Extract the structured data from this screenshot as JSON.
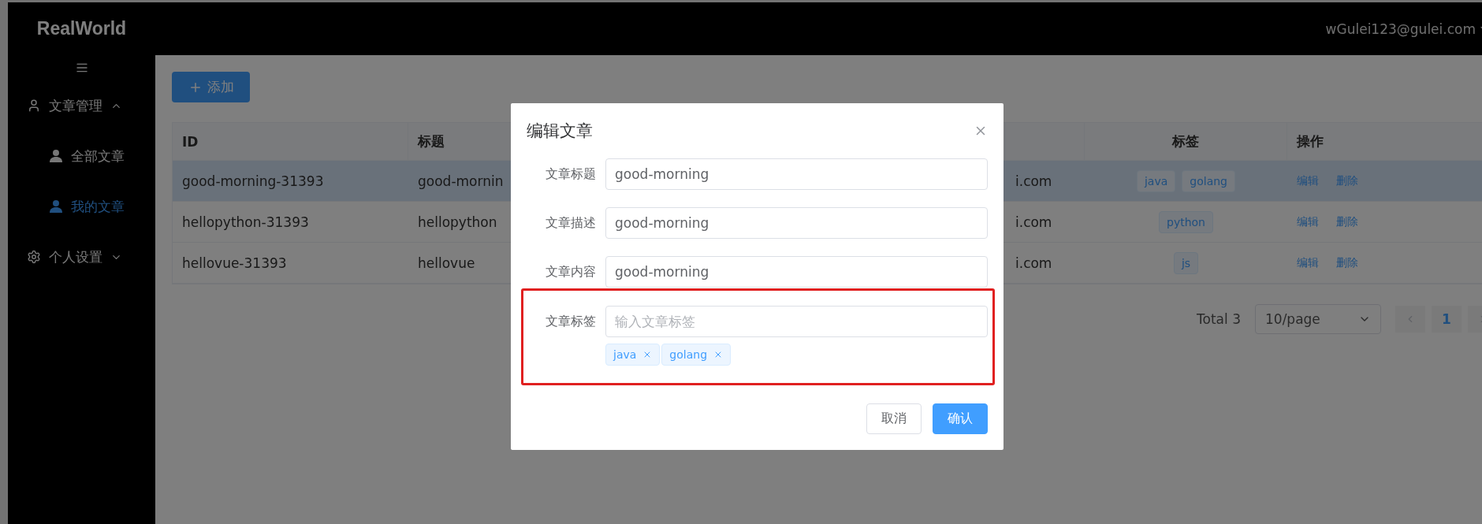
{
  "header": {
    "logo": "RealWorld",
    "user": "wGulei123@gulei.com"
  },
  "sidebar": {
    "items": [
      {
        "label": "文章管理",
        "expanded": true,
        "children": [
          {
            "label": "全部文章",
            "selected": false
          },
          {
            "label": "我的文章",
            "selected": true
          }
        ]
      },
      {
        "label": "个人设置",
        "expanded": false
      }
    ]
  },
  "toolbar": {
    "add_button": "添加"
  },
  "table": {
    "columns": {
      "id": "ID",
      "title": "标题",
      "tags": "标签",
      "actions": "操作"
    },
    "rows": [
      {
        "id": "good-morning-31393",
        "title": "good-mornin",
        "column_4": "i.com",
        "tags": [
          "java",
          "golang"
        ],
        "actions": [
          "编辑",
          "删除"
        ],
        "highlighted": true
      },
      {
        "id": "hellopython-31393",
        "title": "hellopython",
        "column_4": "i.com",
        "tags": [
          "python"
        ],
        "actions": [
          "编辑",
          "删除"
        ],
        "highlighted": false
      },
      {
        "id": "hellovue-31393",
        "title": "hellovue",
        "column_4": "i.com",
        "tags": [
          "js"
        ],
        "actions": [
          "编辑",
          "删除"
        ],
        "highlighted": false
      }
    ]
  },
  "pagination": {
    "total": "Total 3",
    "page_size": "10/page",
    "pages": [
      {
        "label": "1",
        "selected": true
      }
    ]
  },
  "dialog": {
    "title": "编辑文章",
    "fields": [
      {
        "label": "文章标题",
        "value": "good-morning",
        "annotated": false
      },
      {
        "label": "文章描述",
        "value": "good-morning",
        "annotated": false
      },
      {
        "label": "文章内容",
        "value": "good-morning",
        "annotated": false
      },
      {
        "label": "文章标签",
        "placeholder": "输入文章标签",
        "tags": [
          "java",
          "golang"
        ],
        "annotated": true
      }
    ],
    "buttons": [
      {
        "label": "取消",
        "kind": "default"
      },
      {
        "label": "确认",
        "kind": "primary"
      }
    ]
  }
}
